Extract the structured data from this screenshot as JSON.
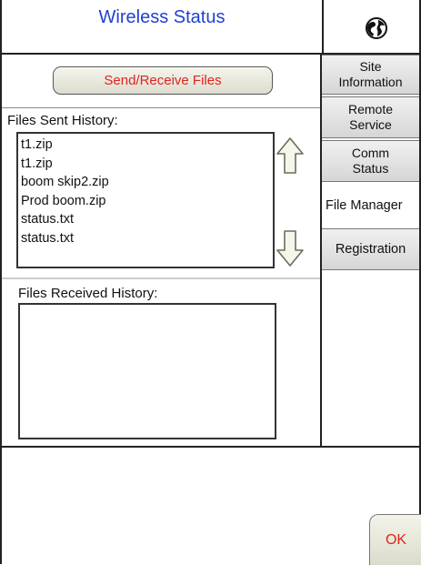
{
  "window": {
    "title": "Wireless Status"
  },
  "header": {
    "icon": "globe-icon"
  },
  "actions": {
    "send_receive_label": "Send/Receive Files"
  },
  "sent_history": {
    "label": "Files Sent History:",
    "items": [
      "t1.zip",
      "t1.zip",
      "boom skip2.zip",
      "Prod boom.zip",
      "status.txt",
      "status.txt"
    ]
  },
  "received_history": {
    "label": "Files Received History:",
    "items": []
  },
  "tabs": [
    {
      "label": "Site Information",
      "active": false
    },
    {
      "label": "Remote Service",
      "active": false
    },
    {
      "label": "Comm Status",
      "active": false
    },
    {
      "label": "File Manager",
      "active": true
    },
    {
      "label": "Registration",
      "active": false
    }
  ],
  "footer": {
    "ok_label": "OK"
  },
  "colors": {
    "title": "#1f3fd6",
    "button_text": "#e0241f"
  }
}
